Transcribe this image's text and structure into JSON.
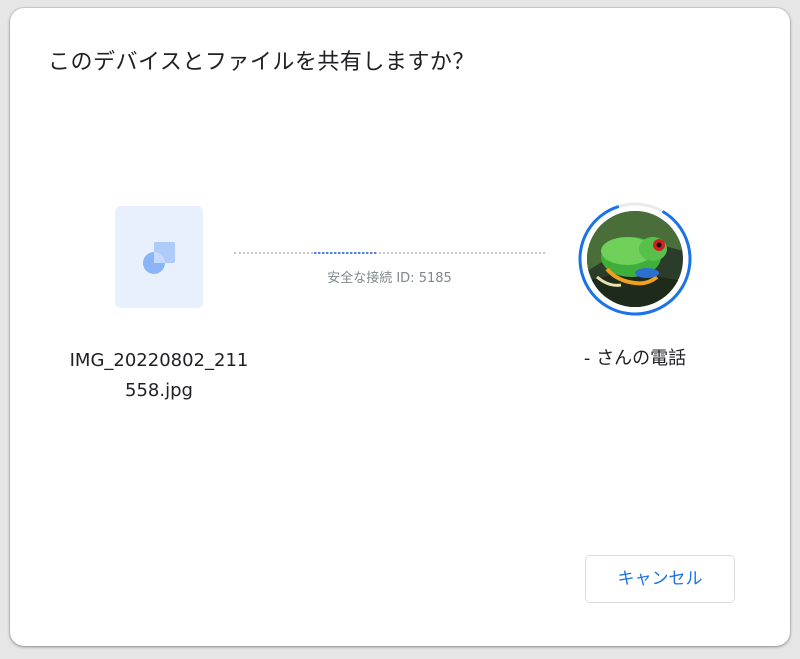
{
  "dialog": {
    "title": "このデバイスとファイルを共有しますか？"
  },
  "file": {
    "name": "IMG_20220802_211558.jpg",
    "icon": "image-file-icon"
  },
  "connection": {
    "label": "安全な接続 ID: 5185"
  },
  "receiver": {
    "device_name": "- さんの電話",
    "avatar": "frog-avatar"
  },
  "actions": {
    "cancel_label": "キャンセル"
  },
  "colors": {
    "accent": "#1a73e8",
    "file_tile": "#e8f0fe",
    "progress_ring": "#1a73e8"
  }
}
